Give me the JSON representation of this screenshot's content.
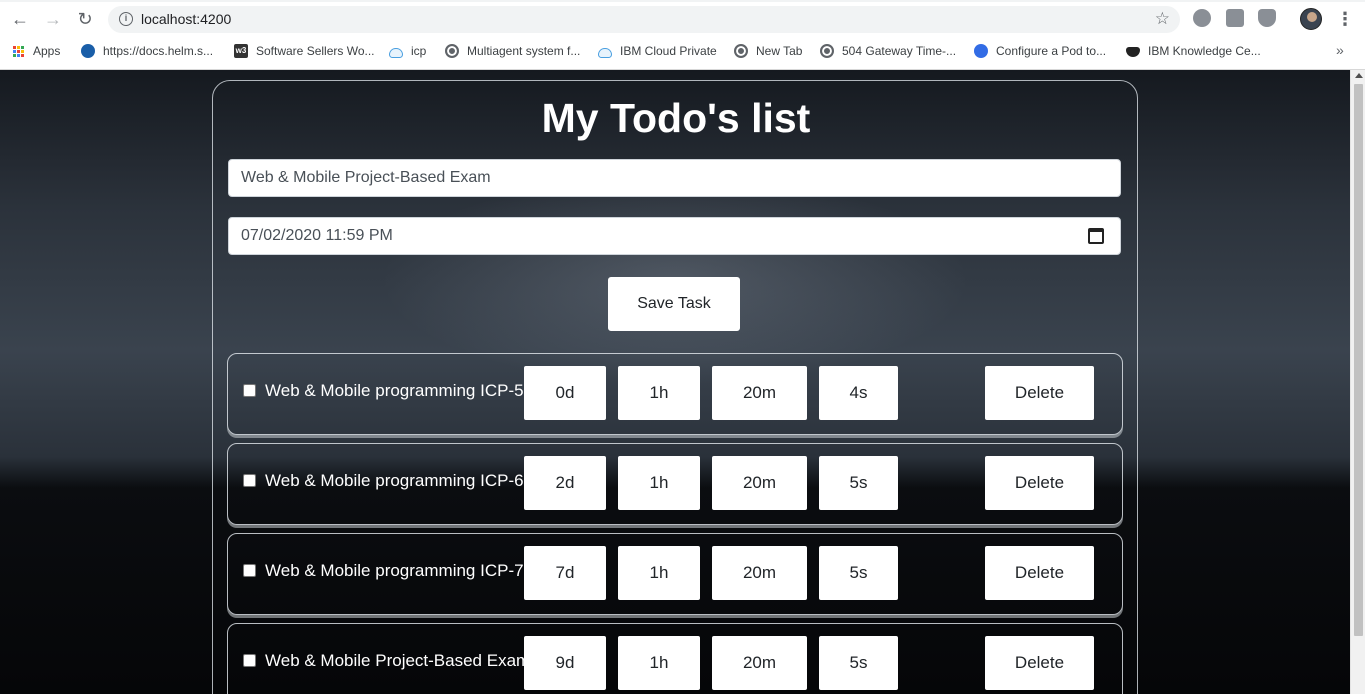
{
  "browser": {
    "url": "localhost:4200",
    "bookmarks": [
      {
        "label": "Apps",
        "icon": "apps-grid-icon"
      },
      {
        "label": "https://docs.helm.s...",
        "icon": "helm-icon"
      },
      {
        "label": "Software Sellers Wo...",
        "icon": "w3-icon"
      },
      {
        "label": "icp",
        "icon": "cloud-icon"
      },
      {
        "label": "Multiagent system f...",
        "icon": "globe-icon"
      },
      {
        "label": "IBM Cloud Private",
        "icon": "cloud-icon"
      },
      {
        "label": "New Tab",
        "icon": "globe-icon"
      },
      {
        "label": "504 Gateway Time-...",
        "icon": "globe-icon"
      },
      {
        "label": "Configure a Pod to...",
        "icon": "kubernetes-icon"
      },
      {
        "label": "IBM Knowledge Ce...",
        "icon": "ibm-icon"
      }
    ],
    "bookmarks_overflow": "»"
  },
  "app": {
    "title": "My Todo's list",
    "task_input_value": "Web & Mobile Project-Based Exam",
    "date_input_value": "07/02/2020 11:59 PM",
    "save_label": "Save Task",
    "tasks": [
      {
        "name": "Web & Mobile programming ICP-5",
        "days": "0d",
        "hours": "1h",
        "minutes": "20m",
        "seconds": "4s",
        "delete_label": "Delete",
        "checked": false
      },
      {
        "name": "Web & Mobile programming ICP-6",
        "days": "2d",
        "hours": "1h",
        "minutes": "20m",
        "seconds": "5s",
        "delete_label": "Delete",
        "checked": false
      },
      {
        "name": "Web & Mobile programming ICP-7",
        "days": "7d",
        "hours": "1h",
        "minutes": "20m",
        "seconds": "5s",
        "delete_label": "Delete",
        "checked": false
      },
      {
        "name": "Web & Mobile Project-Based Exam",
        "days": "9d",
        "hours": "1h",
        "minutes": "20m",
        "seconds": "5s",
        "delete_label": "Delete",
        "checked": false
      }
    ]
  },
  "colors": {
    "page_background": "#1b1f24",
    "card_border": "#e6ebf0",
    "text_light": "#ffffff"
  }
}
